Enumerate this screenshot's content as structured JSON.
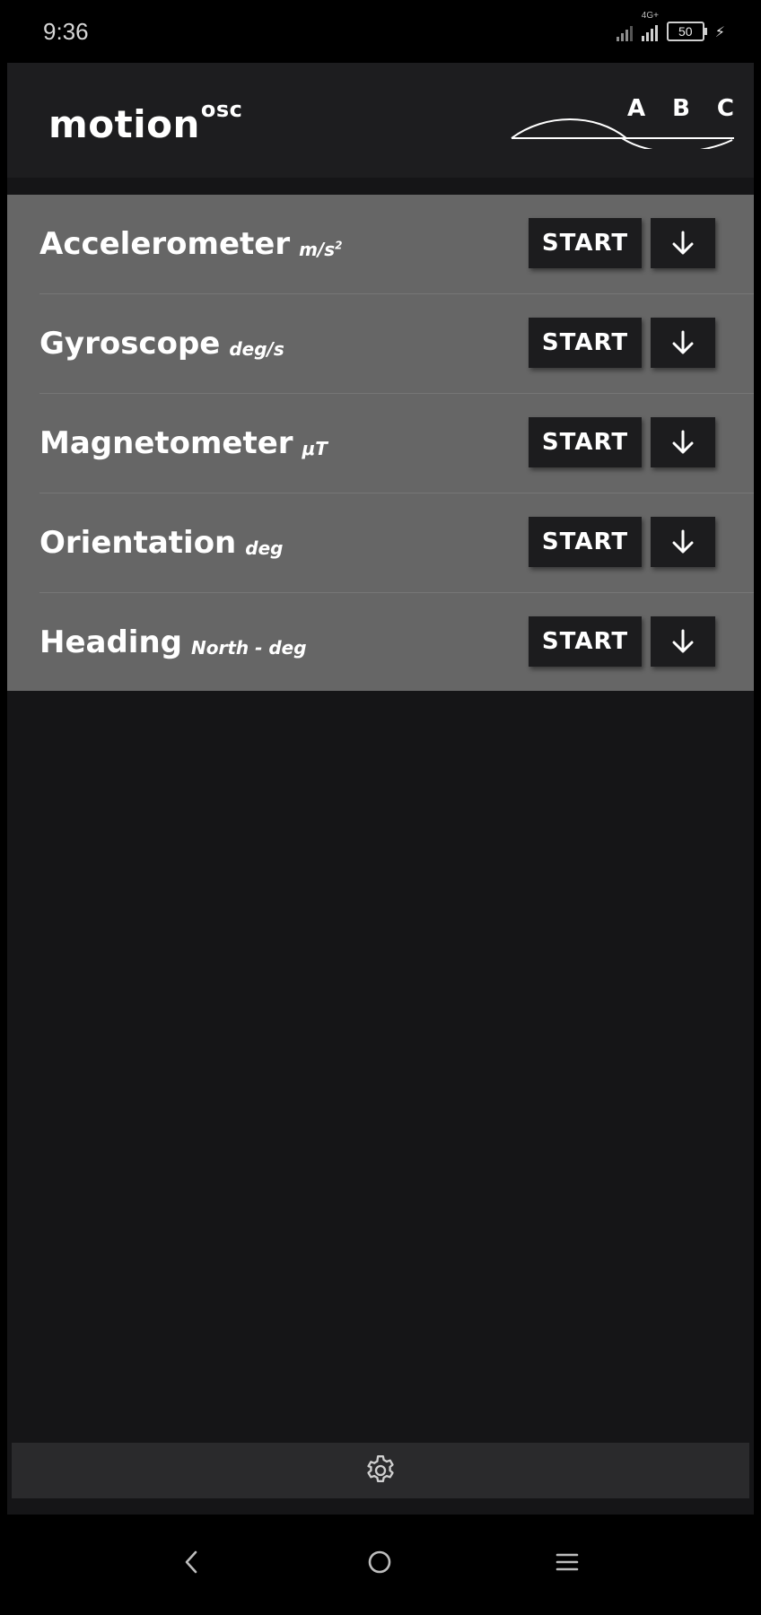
{
  "status_bar": {
    "time": "9:36",
    "network_label": "4G+",
    "battery_level": "50",
    "charging": true
  },
  "app": {
    "logo_main": "motion",
    "logo_sup": "osc",
    "header_letters": [
      "A",
      "B",
      "C"
    ],
    "start_label": "START",
    "sensors": [
      {
        "name": "Accelerometer",
        "unit": "m/s",
        "unit_sup": "2"
      },
      {
        "name": "Gyroscope",
        "unit": "deg/s",
        "unit_sup": ""
      },
      {
        "name": "Magnetometer",
        "unit": "μT",
        "unit_sup": ""
      },
      {
        "name": "Orientation",
        "unit": "deg",
        "unit_sup": ""
      },
      {
        "name": "Heading",
        "unit": "North - deg",
        "unit_sup": ""
      }
    ]
  },
  "icons": {
    "download": "arrow-down-icon",
    "settings": "gear-icon",
    "nav_back": "chevron-left-icon",
    "nav_home": "circle-home-icon",
    "nav_menu": "menu-icon"
  },
  "colors": {
    "list_background": "#666666",
    "app_background": "#151517",
    "header_background": "#1d1d1f",
    "button_background": "#1c1c1e"
  }
}
